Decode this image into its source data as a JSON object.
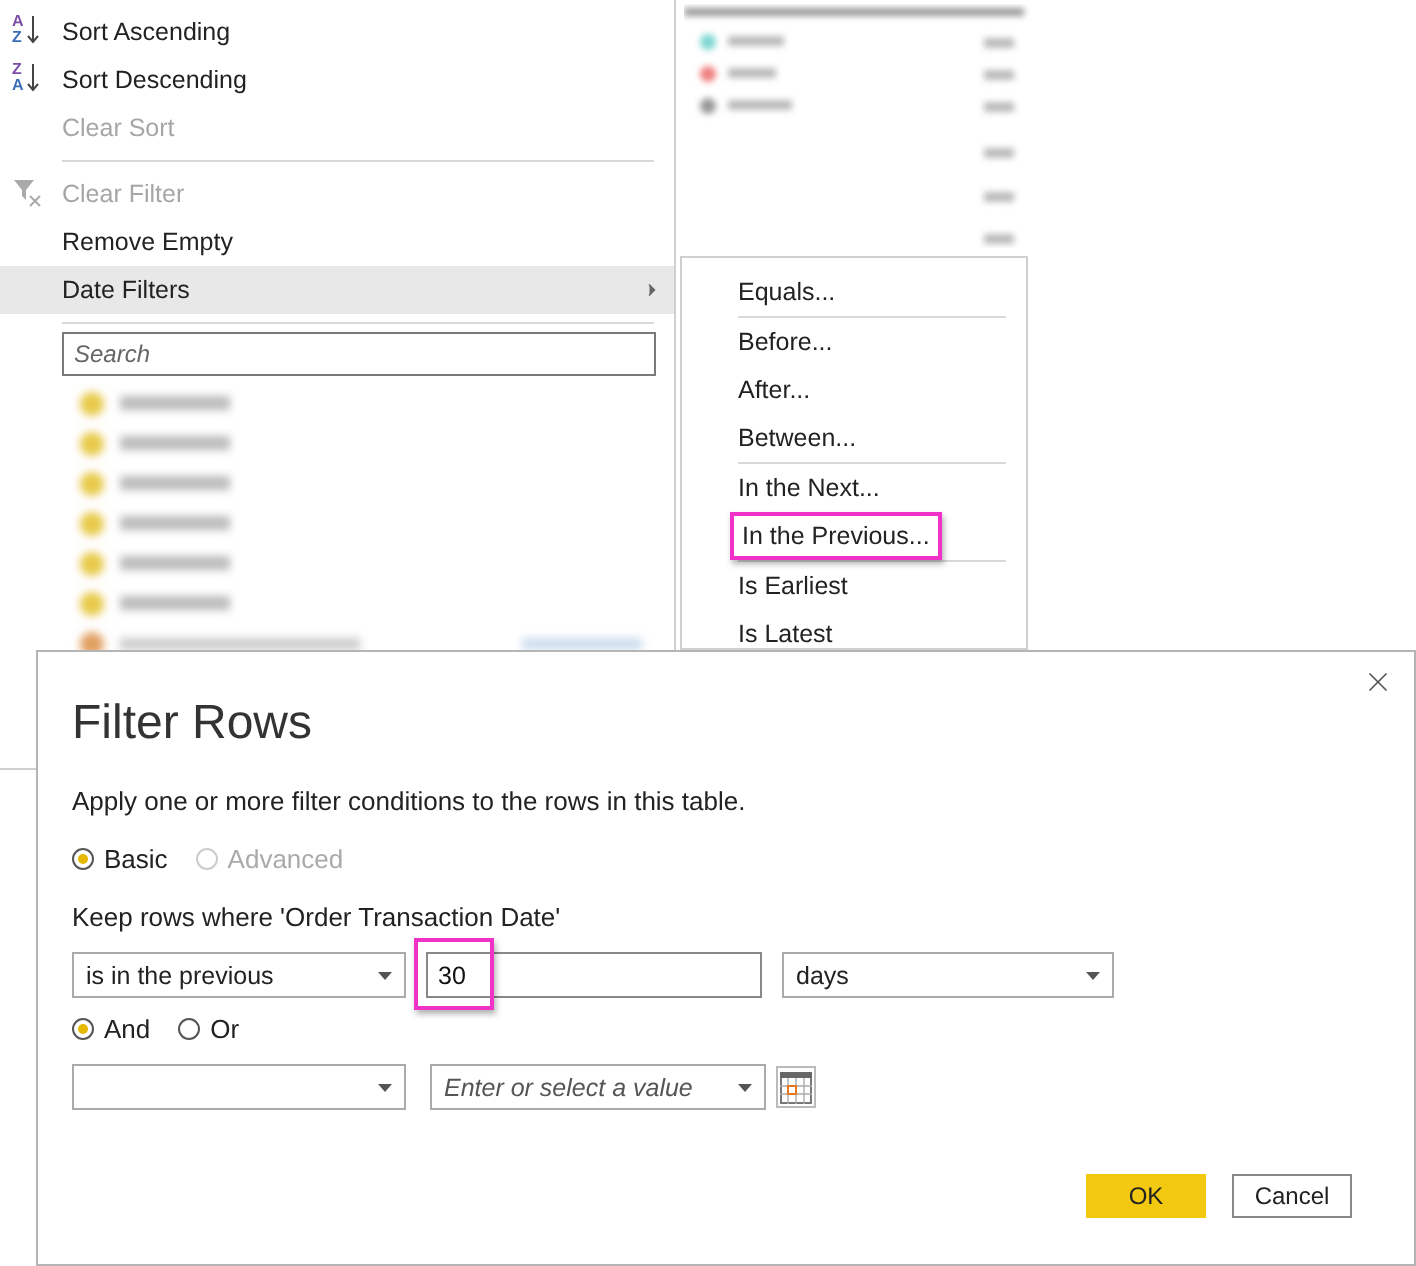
{
  "menu": {
    "items": [
      {
        "kind": "sort",
        "icon_letters": [
          "A",
          "Z"
        ],
        "label": "Sort Ascending",
        "disabled": false,
        "highlighted": false
      },
      {
        "kind": "sort",
        "icon_letters": [
          "Z",
          "A"
        ],
        "label": "Sort Descending",
        "disabled": false,
        "highlighted": false
      },
      {
        "kind": "plain",
        "label": "Clear Sort",
        "disabled": true,
        "highlighted": false
      },
      {
        "kind": "separator"
      },
      {
        "kind": "clear_filter",
        "label": "Clear Filter",
        "disabled": true,
        "highlighted": false
      },
      {
        "kind": "plain",
        "label": "Remove Empty",
        "disabled": false,
        "highlighted": false
      },
      {
        "kind": "submenu",
        "label": "Date Filters",
        "disabled": false,
        "highlighted": true
      },
      {
        "kind": "separator"
      }
    ],
    "search": {
      "placeholder": "Search"
    }
  },
  "submenu": {
    "items": [
      {
        "kind": "item",
        "label": "Equals...",
        "callout": false
      },
      {
        "kind": "separator"
      },
      {
        "kind": "item",
        "label": "Before...",
        "callout": false
      },
      {
        "kind": "item",
        "label": "After...",
        "callout": false
      },
      {
        "kind": "item",
        "label": "Between...",
        "callout": false
      },
      {
        "kind": "separator"
      },
      {
        "kind": "item",
        "label": "In the Next...",
        "callout": false
      },
      {
        "kind": "item",
        "label": "In the Previous...",
        "callout": true
      },
      {
        "kind": "separator"
      },
      {
        "kind": "item",
        "label": "Is Earliest",
        "callout": false
      },
      {
        "kind": "item",
        "label": "Is Latest",
        "callout": false
      }
    ]
  },
  "dialog": {
    "title": "Filter Rows",
    "description": "Apply one or more filter conditions to the rows in this table.",
    "modes": [
      {
        "label": "Basic",
        "selected": true,
        "disabled": false
      },
      {
        "label": "Advanced",
        "selected": false,
        "disabled": true
      }
    ],
    "keep_label": "Keep rows where 'Order Transaction Date'",
    "conditions": [
      {
        "operator": "is in the previous",
        "value": "30",
        "value_callout": true,
        "unit": "days"
      }
    ],
    "logic": [
      {
        "label": "And",
        "selected": true
      },
      {
        "label": "Or",
        "selected": false
      }
    ],
    "extra_condition": {
      "placeholder": "Enter or select a value"
    },
    "buttons": [
      {
        "label": "OK",
        "kind": "primary"
      },
      {
        "label": "Cancel",
        "kind": "secondary"
      }
    ]
  }
}
